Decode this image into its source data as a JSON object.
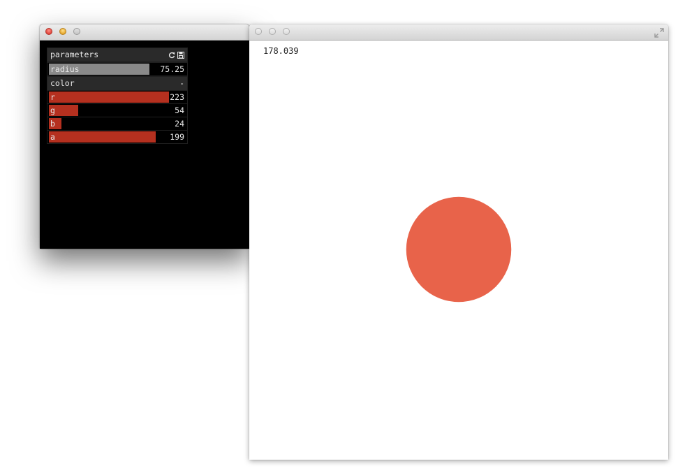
{
  "gui": {
    "title": "parameters",
    "reset_icon": "refresh-icon",
    "save_icon": "save-icon",
    "radius": {
      "label": "radius",
      "value": "75.25"
    },
    "color_group": {
      "label": "color",
      "toggle": "-"
    },
    "channels": [
      {
        "label": "r",
        "value": "223",
        "fraction": 0.875
      },
      {
        "label": "g",
        "value": "54",
        "fraction": 0.212
      },
      {
        "label": "b",
        "value": "24",
        "fraction": 0.094
      },
      {
        "label": "a",
        "value": "199",
        "fraction": 0.78
      }
    ],
    "slider_color": "#b5301f",
    "radius_fill_color": "#8a8a8a",
    "radius_fraction": 0.73
  },
  "canvas": {
    "fps": "178.039",
    "circle_color": "#e8634a",
    "circle_radius": 75.25
  },
  "window": {
    "fullscreen_icon": "fullscreen-icon"
  }
}
